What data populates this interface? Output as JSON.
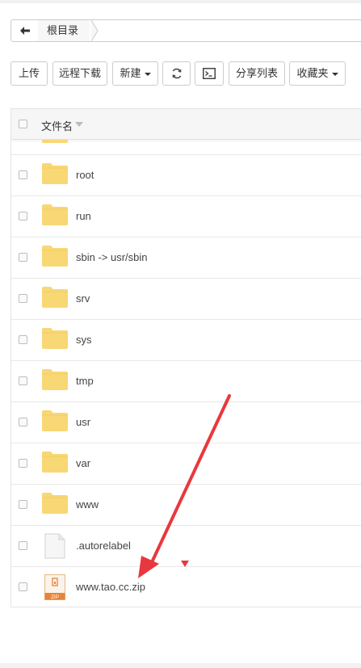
{
  "breadcrumb": {
    "root_label": "根目录"
  },
  "toolbar": {
    "upload": "上传",
    "remote_download": "远程下载",
    "new": "新建",
    "share_list": "分享列表",
    "favorites": "收藏夹"
  },
  "table": {
    "header": {
      "name": "文件名"
    },
    "rows": [
      {
        "name": "",
        "type": "folder"
      },
      {
        "name": "root",
        "type": "folder"
      },
      {
        "name": "run",
        "type": "folder"
      },
      {
        "name": "sbin -> usr/sbin",
        "type": "folder"
      },
      {
        "name": "srv",
        "type": "folder"
      },
      {
        "name": "sys",
        "type": "folder"
      },
      {
        "name": "tmp",
        "type": "folder"
      },
      {
        "name": "usr",
        "type": "folder"
      },
      {
        "name": "var",
        "type": "folder"
      },
      {
        "name": "www",
        "type": "folder"
      },
      {
        "name": ".autorelabel",
        "type": "file"
      },
      {
        "name": "www.tao.cc.zip",
        "type": "zip"
      }
    ]
  },
  "icons": {
    "back": "arrow-left-icon",
    "refresh": "refresh-icon",
    "terminal": "terminal-icon",
    "folder": "folder-icon",
    "file": "file-icon",
    "zip": "zip-file-icon",
    "zip_badge": "ZIP"
  },
  "colors": {
    "folder": "#f8d775",
    "annotation": "#e8383d",
    "zip_accent": "#e8843a"
  }
}
